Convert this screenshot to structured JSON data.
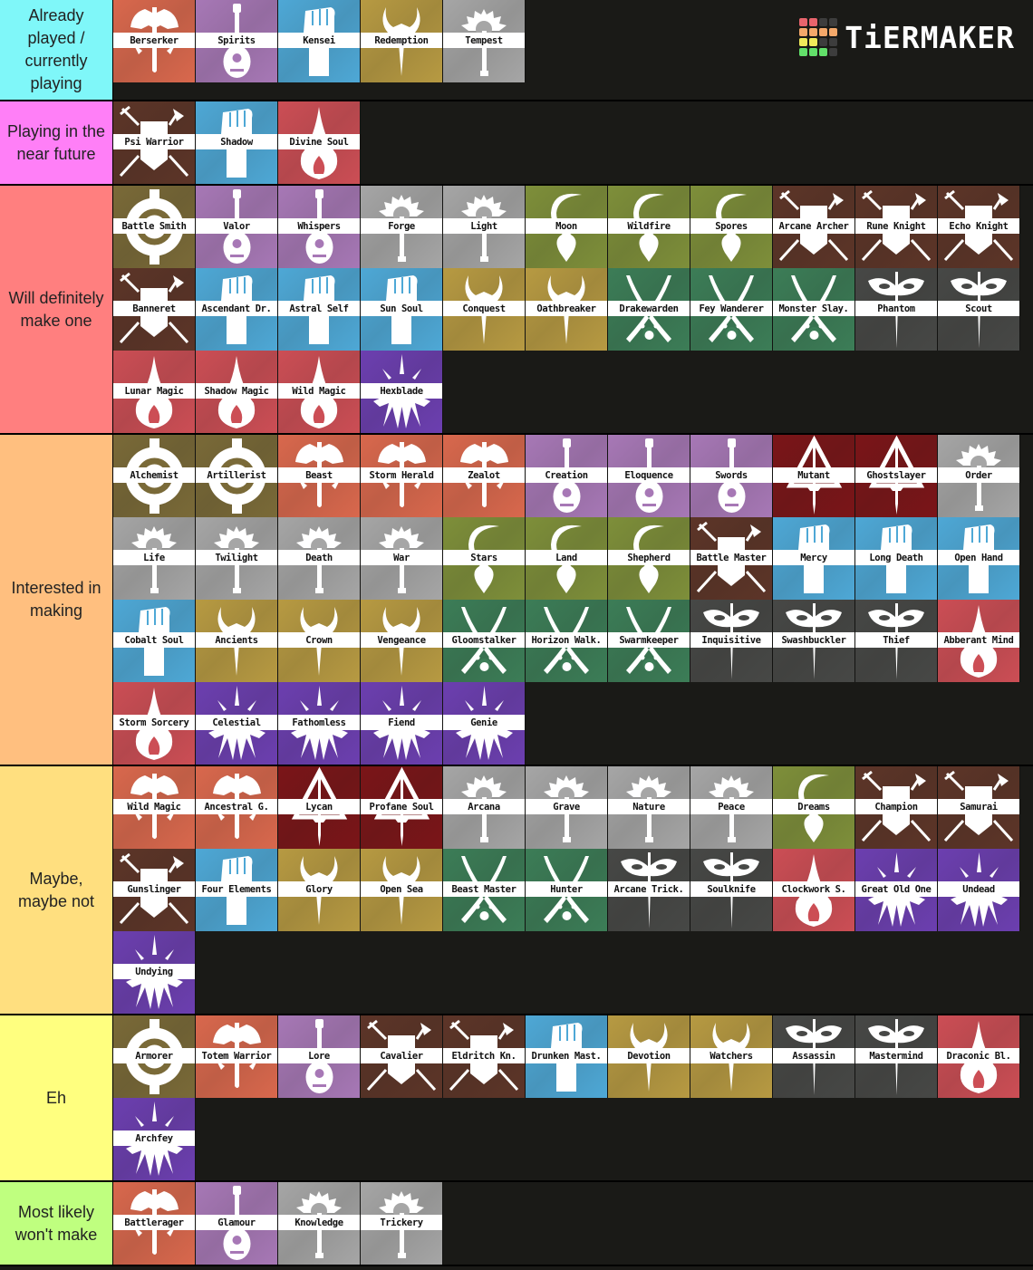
{
  "brand": {
    "name": "TiERMAKER",
    "grid_colors": [
      "#e8646c",
      "#e8646c",
      "#3d3d3d",
      "#3d3d3d",
      "#f4a86a",
      "#f4a86a",
      "#f4a86a",
      "#f4a86a",
      "#f0ea5a",
      "#f0ea5a",
      "#3d3d3d",
      "#3d3d3d",
      "#62e06a",
      "#62e06a",
      "#62e06a",
      "#3d3d3d"
    ]
  },
  "class_styles": {
    "barbarian": {
      "icon": "greataxe-icon",
      "color": "#d9684d"
    },
    "bard": {
      "icon": "lute-icon",
      "color": "#a778b6"
    },
    "monk": {
      "icon": "fist-icon",
      "color": "#4ea8d6"
    },
    "paladin": {
      "icon": "horned-helm-icon",
      "color": "#b79a42"
    },
    "cleric": {
      "icon": "sun-mace-icon",
      "color": "#a6a6a6"
    },
    "fighter": {
      "icon": "shield-weapons-icon",
      "color": "#5d3528"
    },
    "sorcerer": {
      "icon": "flame-drop-icon",
      "color": "#cc4e55"
    },
    "artificer": {
      "icon": "gear-icon",
      "color": "#7a6a38"
    },
    "druid": {
      "icon": "sickle-icon",
      "color": "#7e8f3a"
    },
    "ranger": {
      "icon": "crossed-blades-paw-icon",
      "color": "#3c7d57"
    },
    "rogue": {
      "icon": "mask-dagger-icon",
      "color": "#474846"
    },
    "warlock": {
      "icon": "eldritch-burst-icon",
      "color": "#6c3fb0"
    },
    "bloodhunter": {
      "icon": "triangle-dagger-icon",
      "color": "#7b1518"
    }
  },
  "tiers": [
    {
      "label": "Already played / currently playing",
      "color": "#7ff7f9",
      "rows": 1,
      "items": [
        {
          "name": "Berserker",
          "cls": "barbarian"
        },
        {
          "name": "Spirits",
          "cls": "bard"
        },
        {
          "name": "Kensei",
          "cls": "monk"
        },
        {
          "name": "Redemption",
          "cls": "paladin"
        },
        {
          "name": "Tempest",
          "cls": "cleric"
        }
      ]
    },
    {
      "label": "Playing in the near future",
      "color": "#ff7ff7",
      "rows": 1,
      "items": [
        {
          "name": "Psi Warrior",
          "cls": "fighter"
        },
        {
          "name": "Shadow",
          "cls": "monk"
        },
        {
          "name": "Divine Soul",
          "cls": "sorcerer"
        }
      ]
    },
    {
      "label": "Will definitely make one",
      "color": "#ff7f7f",
      "rows": 3,
      "items": [
        {
          "name": "Battle Smith",
          "cls": "artificer"
        },
        {
          "name": "Valor",
          "cls": "bard"
        },
        {
          "name": "Whispers",
          "cls": "bard"
        },
        {
          "name": "Forge",
          "cls": "cleric"
        },
        {
          "name": "Light",
          "cls": "cleric"
        },
        {
          "name": "Moon",
          "cls": "druid"
        },
        {
          "name": "Wildfire",
          "cls": "druid"
        },
        {
          "name": "Spores",
          "cls": "druid"
        },
        {
          "name": "Arcane Archer",
          "cls": "fighter"
        },
        {
          "name": "Rune Knight",
          "cls": "fighter"
        },
        {
          "name": "Echo Knight",
          "cls": "fighter"
        },
        {
          "name": "Banneret",
          "cls": "fighter"
        },
        {
          "name": "Ascendant Dr.",
          "cls": "monk"
        },
        {
          "name": "Astral Self",
          "cls": "monk"
        },
        {
          "name": "Sun Soul",
          "cls": "monk"
        },
        {
          "name": "Conquest",
          "cls": "paladin"
        },
        {
          "name": "Oathbreaker",
          "cls": "paladin"
        },
        {
          "name": "Drakewarden",
          "cls": "ranger"
        },
        {
          "name": "Fey Wanderer",
          "cls": "ranger"
        },
        {
          "name": "Monster Slay.",
          "cls": "ranger"
        },
        {
          "name": "Phantom",
          "cls": "rogue"
        },
        {
          "name": "Scout",
          "cls": "rogue"
        },
        {
          "name": "Lunar Magic",
          "cls": "sorcerer"
        },
        {
          "name": "Shadow Magic",
          "cls": "sorcerer"
        },
        {
          "name": "Wild Magic",
          "cls": "sorcerer"
        },
        {
          "name": "Hexblade",
          "cls": "warlock"
        }
      ]
    },
    {
      "label": "Interested in making",
      "color": "#ffbf7f",
      "rows": 4,
      "items": [
        {
          "name": "Alchemist",
          "cls": "artificer"
        },
        {
          "name": "Artillerist",
          "cls": "artificer"
        },
        {
          "name": "Beast",
          "cls": "barbarian"
        },
        {
          "name": "Storm Herald",
          "cls": "barbarian"
        },
        {
          "name": "Zealot",
          "cls": "barbarian"
        },
        {
          "name": "Creation",
          "cls": "bard"
        },
        {
          "name": "Eloquence",
          "cls": "bard"
        },
        {
          "name": "Swords",
          "cls": "bard"
        },
        {
          "name": "Mutant",
          "cls": "bloodhunter"
        },
        {
          "name": "Ghostslayer",
          "cls": "bloodhunter"
        },
        {
          "name": "Order",
          "cls": "cleric"
        },
        {
          "name": "Life",
          "cls": "cleric"
        },
        {
          "name": "Twilight",
          "cls": "cleric"
        },
        {
          "name": "Death",
          "cls": "cleric"
        },
        {
          "name": "War",
          "cls": "cleric"
        },
        {
          "name": "Stars",
          "cls": "druid"
        },
        {
          "name": "Land",
          "cls": "druid"
        },
        {
          "name": "Shepherd",
          "cls": "druid"
        },
        {
          "name": "Battle Master",
          "cls": "fighter"
        },
        {
          "name": "Mercy",
          "cls": "monk"
        },
        {
          "name": "Long Death",
          "cls": "monk"
        },
        {
          "name": "Open Hand",
          "cls": "monk"
        },
        {
          "name": "Cobalt Soul",
          "cls": "monk"
        },
        {
          "name": "Ancients",
          "cls": "paladin"
        },
        {
          "name": "Crown",
          "cls": "paladin"
        },
        {
          "name": "Vengeance",
          "cls": "paladin"
        },
        {
          "name": "Gloomstalker",
          "cls": "ranger"
        },
        {
          "name": "Horizon Walk.",
          "cls": "ranger"
        },
        {
          "name": "Swarmkeeper",
          "cls": "ranger"
        },
        {
          "name": "Inquisitive",
          "cls": "rogue"
        },
        {
          "name": "Swashbuckler",
          "cls": "rogue"
        },
        {
          "name": "Thief",
          "cls": "rogue"
        },
        {
          "name": "Abberant Mind",
          "cls": "sorcerer"
        },
        {
          "name": "Storm Sorcery",
          "cls": "sorcerer"
        },
        {
          "name": "Celestial",
          "cls": "warlock"
        },
        {
          "name": "Fathomless",
          "cls": "warlock"
        },
        {
          "name": "Fiend",
          "cls": "warlock"
        },
        {
          "name": "Genie",
          "cls": "warlock"
        }
      ]
    },
    {
      "label": "Maybe, maybe not",
      "color": "#ffdf7f",
      "rows": 3,
      "items": [
        {
          "name": "Wild Magic",
          "cls": "barbarian"
        },
        {
          "name": "Ancestral G.",
          "cls": "barbarian"
        },
        {
          "name": "Lycan",
          "cls": "bloodhunter"
        },
        {
          "name": "Profane Soul",
          "cls": "bloodhunter"
        },
        {
          "name": "Arcana",
          "cls": "cleric"
        },
        {
          "name": "Grave",
          "cls": "cleric"
        },
        {
          "name": "Nature",
          "cls": "cleric"
        },
        {
          "name": "Peace",
          "cls": "cleric"
        },
        {
          "name": "Dreams",
          "cls": "druid"
        },
        {
          "name": "Champion",
          "cls": "fighter"
        },
        {
          "name": "Samurai",
          "cls": "fighter"
        },
        {
          "name": "Gunslinger",
          "cls": "fighter"
        },
        {
          "name": "Four Elements",
          "cls": "monk"
        },
        {
          "name": "Glory",
          "cls": "paladin"
        },
        {
          "name": "Open Sea",
          "cls": "paladin"
        },
        {
          "name": "Beast Master",
          "cls": "ranger"
        },
        {
          "name": "Hunter",
          "cls": "ranger"
        },
        {
          "name": "Arcane Trick.",
          "cls": "rogue"
        },
        {
          "name": "Soulknife",
          "cls": "rogue"
        },
        {
          "name": "Clockwork S.",
          "cls": "sorcerer"
        },
        {
          "name": "Great Old One",
          "cls": "warlock"
        },
        {
          "name": "Undead",
          "cls": "warlock"
        },
        {
          "name": "Undying",
          "cls": "warlock"
        }
      ]
    },
    {
      "label": "Eh",
      "color": "#ffff7f",
      "rows": 2,
      "items": [
        {
          "name": "Armorer",
          "cls": "artificer"
        },
        {
          "name": "Totem Warrior",
          "cls": "barbarian"
        },
        {
          "name": "Lore",
          "cls": "bard"
        },
        {
          "name": "Cavalier",
          "cls": "fighter"
        },
        {
          "name": "Eldritch Kn.",
          "cls": "fighter"
        },
        {
          "name": "Drunken Mast.",
          "cls": "monk"
        },
        {
          "name": "Devotion",
          "cls": "paladin"
        },
        {
          "name": "Watchers",
          "cls": "paladin"
        },
        {
          "name": "Assassin",
          "cls": "rogue"
        },
        {
          "name": "Mastermind",
          "cls": "rogue"
        },
        {
          "name": "Draconic Bl.",
          "cls": "sorcerer"
        },
        {
          "name": "Archfey",
          "cls": "warlock"
        }
      ]
    },
    {
      "label": "Most likely won't make",
      "color": "#bfff7f",
      "rows": 1,
      "items": [
        {
          "name": "Battlerager",
          "cls": "barbarian"
        },
        {
          "name": "Glamour",
          "cls": "bard"
        },
        {
          "name": "Knowledge",
          "cls": "cleric"
        },
        {
          "name": "Trickery",
          "cls": "cleric"
        }
      ]
    }
  ]
}
